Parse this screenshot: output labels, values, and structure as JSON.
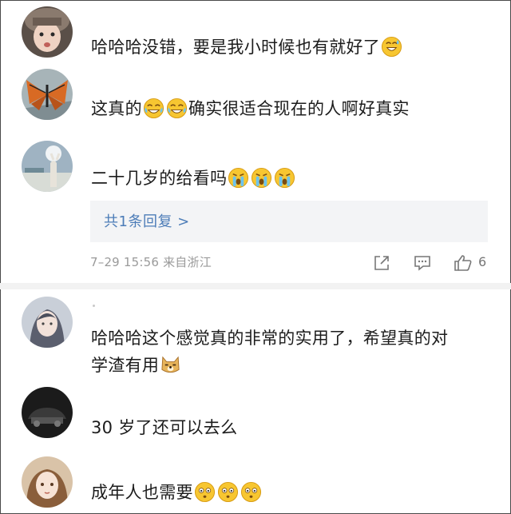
{
  "comments": [
    {
      "text": "哈哈哈没错，要是我小时候也有就好了",
      "emoji": [
        "laugh-sweat"
      ]
    },
    {
      "text_before": "这真的",
      "emoji": [
        "tears-of-joy",
        "tears-of-joy"
      ],
      "text_after": "确实很适合现在的人啊好真实"
    },
    {
      "text": "二十几岁的给看吗",
      "emoji": [
        "crying",
        "crying",
        "crying"
      ]
    },
    {
      "line1": "哈哈哈这个感觉真的非常的实用了，希望真的对",
      "line2": "学渣有用",
      "emoji": [
        "doge"
      ]
    },
    {
      "text": "30 岁了还可以去么"
    },
    {
      "text": "成年人也需要",
      "emoji": [
        "speechless",
        "speechless",
        "speechless"
      ]
    }
  ],
  "reply": {
    "label": "共1条回复 >"
  },
  "meta": {
    "date_location": "7–29 15:56  来自浙江",
    "like_count": "6"
  },
  "icons": [
    "share-icon",
    "comment-icon",
    "like-icon"
  ],
  "colors": {
    "link": "#4d7db8",
    "meta": "#9a9a9a",
    "reply_bg": "#f3f4f6",
    "divider": "#f2f2f2"
  }
}
